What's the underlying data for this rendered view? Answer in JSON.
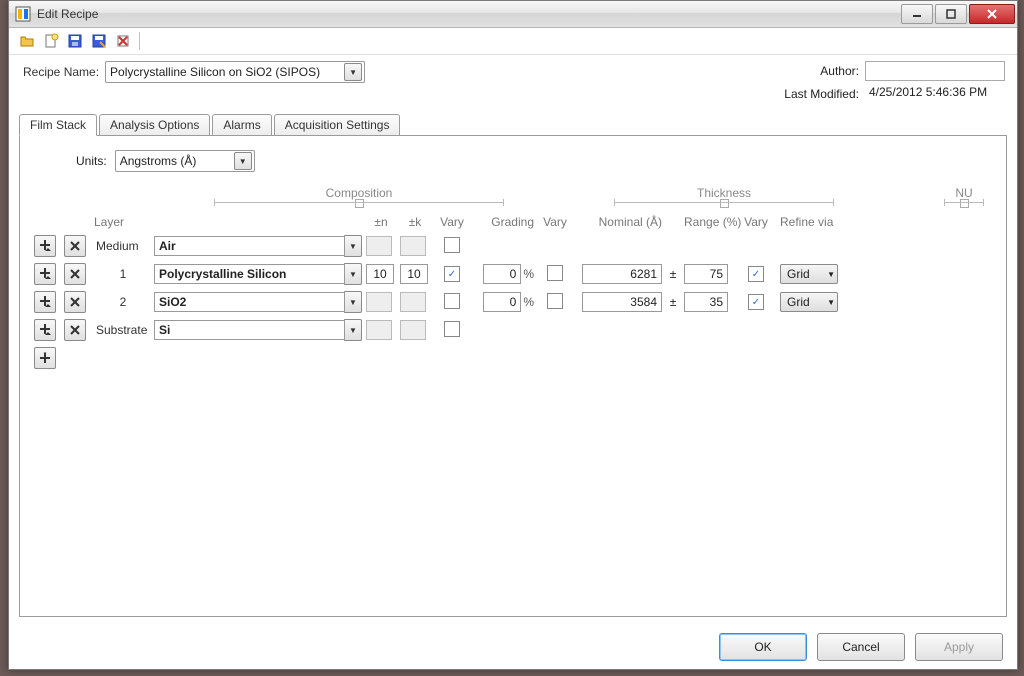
{
  "window": {
    "title": "Edit Recipe"
  },
  "toolbar_icons": [
    "open",
    "new",
    "save",
    "saveas",
    "delete"
  ],
  "header": {
    "recipe_label": "Recipe Name:",
    "recipe_value": "Polycrystalline Silicon on SiO2 (SIPOS)",
    "author_label": "Author:",
    "author_value": "",
    "last_modified_label": "Last Modified:",
    "last_modified_value": "4/25/2012 5:46:36 PM"
  },
  "tabs": {
    "items": [
      "Film Stack",
      "Analysis Options",
      "Alarms",
      "Acquisition Settings"
    ],
    "active_index": 0
  },
  "units": {
    "label": "Units:",
    "value": "Angstroms (Å)"
  },
  "group_headers": {
    "composition": "Composition",
    "thickness": "Thickness",
    "nu": "NU"
  },
  "columns": {
    "layer": "Layer",
    "pm_n": "±n",
    "pm_k": "±k",
    "vary": "Vary",
    "grading": "Grading",
    "grading_vary": "Vary",
    "nominal": "Nominal (Å)",
    "range": "Range (%)",
    "thickness_vary": "Vary",
    "refine_via": "Refine via"
  },
  "rows": [
    {
      "kind": "medium",
      "layer_label": "Medium",
      "material": "Air",
      "pm_n": "",
      "pm_k": "",
      "vary_comp": false,
      "grading": null,
      "vary_grading": null,
      "nominal": null,
      "range": null,
      "vary_thk": null,
      "refine": null
    },
    {
      "kind": "film",
      "layer_label": "1",
      "material": "Polycrystalline Silicon",
      "pm_n": "10",
      "pm_k": "10",
      "vary_comp": true,
      "grading": "0",
      "vary_grading": false,
      "nominal": "6281",
      "range": "75",
      "vary_thk": true,
      "refine": "Grid"
    },
    {
      "kind": "film",
      "layer_label": "2",
      "material": "SiO2",
      "pm_n": "",
      "pm_k": "",
      "vary_comp": false,
      "grading": "0",
      "vary_grading": false,
      "nominal": "3584",
      "range": "35",
      "vary_thk": true,
      "refine": "Grid"
    },
    {
      "kind": "substrate",
      "layer_label": "Substrate",
      "material": "Si",
      "pm_n": "",
      "pm_k": "",
      "vary_comp": false,
      "grading": null,
      "vary_grading": null,
      "nominal": null,
      "range": null,
      "vary_thk": null,
      "refine": null
    }
  ],
  "pm_symbol": "±",
  "pct_symbol": "%",
  "buttons": {
    "ok": "OK",
    "cancel": "Cancel",
    "apply": "Apply"
  }
}
